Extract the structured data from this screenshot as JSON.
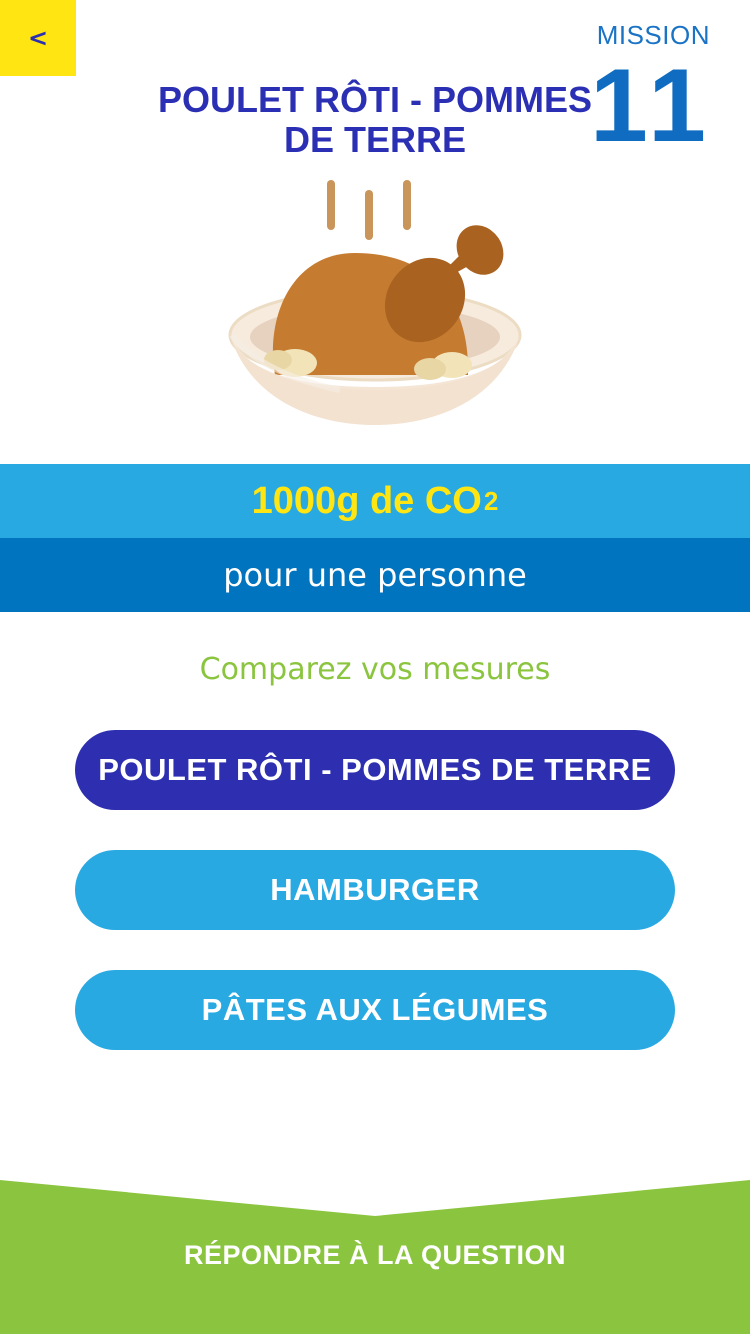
{
  "header": {
    "back_label": "<",
    "mission_label": "MISSION",
    "mission_number": "11",
    "title": "POULET RÔTI - POMMES DE TERRE"
  },
  "illustration": {
    "icon": "roast-chicken-bowl-icon"
  },
  "emission": {
    "amount": "1000g de CO",
    "subscript": "2",
    "per": "pour une personne"
  },
  "compare": {
    "label": "Comparez vos mesures",
    "options": [
      {
        "label": "POULET RÔTI - POMMES DE TERRE",
        "selected": true
      },
      {
        "label": "HAMBURGER",
        "selected": false
      },
      {
        "label": "PÂTES AUX LÉGUMES",
        "selected": false
      }
    ]
  },
  "footer": {
    "answer_label": "RÉPONDRE À LA QUESTION"
  },
  "colors": {
    "back_button": "#ffe512",
    "title_blue": "#2b2fb3",
    "mission_blue": "#0f6cc0",
    "light_blue": "#29a9e2",
    "dark_blue": "#0074be",
    "green": "#8bc53f",
    "emission_yellow": "#ffe512"
  }
}
